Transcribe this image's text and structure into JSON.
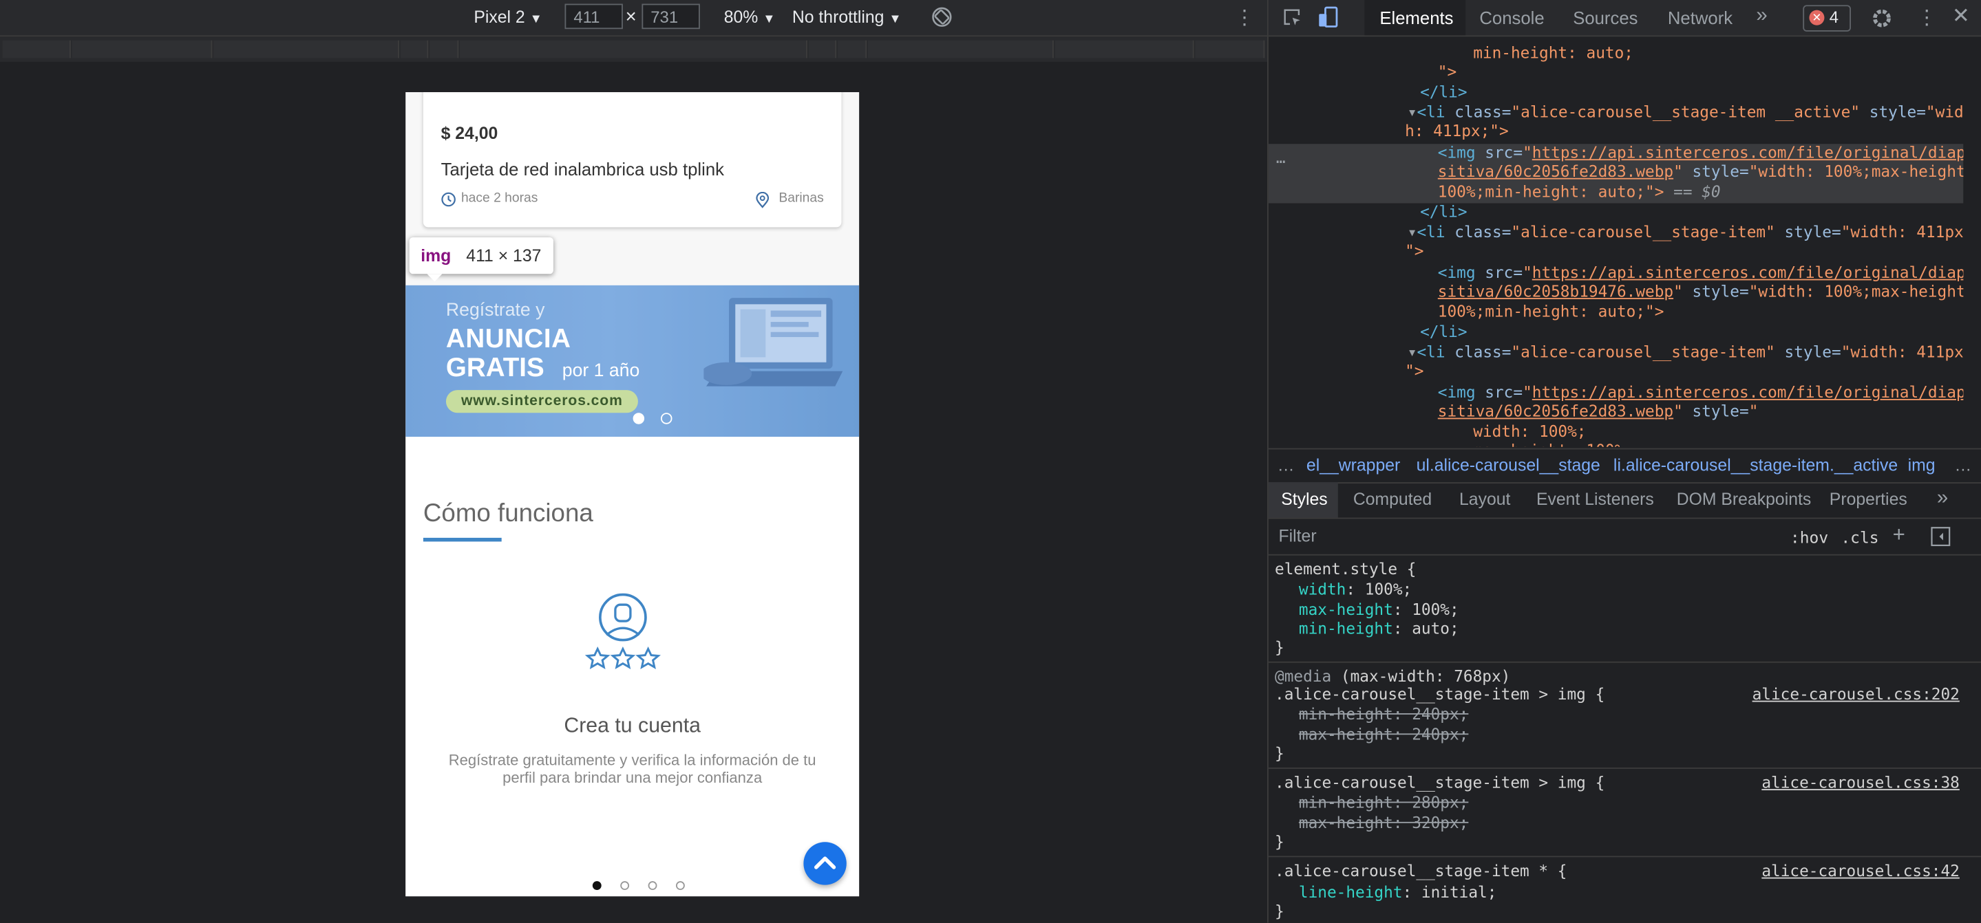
{
  "device_toolbar": {
    "device": "Pixel 2",
    "width": "411",
    "height": "731",
    "times": "×",
    "zoom": "80%",
    "throttling": "No throttling"
  },
  "page": {
    "card": {
      "price": "$ 24,00",
      "title": "Tarjeta de red inalambrica usb tplink",
      "time": "hace 2 horas",
      "location": "Barinas"
    },
    "banner": {
      "line1": "Regístrate y",
      "line2": "ANUNCIA",
      "line3": "GRATIS",
      "line3b": "por 1 año",
      "url": "www.sinterceros.com"
    },
    "how": {
      "title": "Cómo funciona",
      "step_title": "Crea tu cuenta",
      "step_desc": "Regístrate gratuitamente y verifica la información de tu perfil para brindar una mejor confianza"
    }
  },
  "tooltip": {
    "tag": "img",
    "size": "411 × 137"
  },
  "devtools": {
    "tabs": [
      "Elements",
      "Console",
      "Sources",
      "Network",
      "»"
    ],
    "error_count": "4",
    "dom": {
      "l0": "min-height: auto;",
      "l1": "\">",
      "l2": "</li>",
      "li_open": "<li",
      "class_attr": "class=",
      "style_attr": "style=",
      "li_class_active": "\"alice-carousel__stage-item __active\"",
      "li_class": "\"alice-carousel__stage-item\"",
      "li_style_a": "\"widt",
      "li_style_b": "h: 411px;\">",
      "li_style_c": "\"width: 411px;",
      "li_style_d": "\">",
      "img_open": "<img",
      "src_attr": "src=",
      "q": "\"",
      "src1a": "https://api.sinterceros.com/file/original/diapo",
      "src1b": "sitiva/60c2056fe2d83.webp",
      "src2b": "sitiva/60c2058b19476.webp",
      "style_full_a": "\"width: 100%;max-height:",
      "style_full_b": "100%;min-height: auto;\">",
      "eq": "== $0",
      "style_open": "\"",
      "w100": "width: 100%;",
      "mh100": "max-height: 100%;"
    },
    "breadcrumbs": [
      "…",
      "el__wrapper",
      "ul.alice-carousel__stage",
      "li.alice-carousel__stage-item.__active",
      "img",
      "…"
    ],
    "subtabs": [
      "Styles",
      "Computed",
      "Layout",
      "Event Listeners",
      "DOM Breakpoints",
      "Properties",
      "»"
    ],
    "filter_placeholder": "Filter",
    "hov": ":hov",
    "cls": ".cls",
    "styles": {
      "element_style": "element.style {",
      "p_width": "width",
      "v_width": ": 100%;",
      "p_maxh": "max-height",
      "v_maxh": ": 100%;",
      "p_minh": "min-height",
      "v_minh": ": auto;",
      "close": "}",
      "media": "@media",
      "media_q": "(max-width: 768px)",
      "sel1": ".alice-carousel__stage-item > img {",
      "src1": "alice-carousel.css:202",
      "s1a": "min-height: 240px;",
      "s1b": "max-height: 240px;",
      "sel2": ".alice-carousel__stage-item > img {",
      "src2": "alice-carousel.css:38",
      "s2a": "min-height: 280px;",
      "s2b": "max-height: 320px;",
      "sel3": ".alice-carousel__stage-item * {",
      "src3": "alice-carousel.css:42",
      "p_lh": "line-height",
      "v_lh": ": initial;"
    }
  }
}
